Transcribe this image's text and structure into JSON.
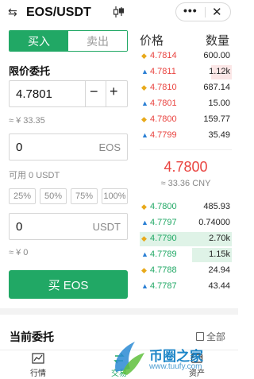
{
  "header": {
    "swap_icon": "⇆",
    "title": "EOS/USDT",
    "kline_icon": "candlestick-icon",
    "more_icon": "•••",
    "close_icon": "✕"
  },
  "form": {
    "tab_buy": "买入",
    "tab_sell": "卖出",
    "order_type": "限价委托",
    "price_value": "4.7801",
    "minus": "−",
    "plus": "+",
    "price_approx": "≈ ¥ 33.35",
    "amount_value": "0",
    "amount_unit": "EOS",
    "available": "可用 0 USDT",
    "pct": [
      "25%",
      "50%",
      "75%",
      "100%"
    ],
    "total_value": "0",
    "total_unit": "USDT",
    "total_approx": "≈ ¥ 0",
    "buy_button": "买 EOS"
  },
  "orderbook": {
    "header_price": "价格",
    "header_qty": "数量",
    "asks": [
      {
        "price": "4.7814",
        "qty": "600.00",
        "fill": 0.0
      },
      {
        "price": "4.7811",
        "qty": "1.12k",
        "fill": 0.22
      },
      {
        "price": "4.7810",
        "qty": "687.14",
        "fill": 0.0
      },
      {
        "price": "4.7801",
        "qty": "15.00",
        "fill": 0.0
      },
      {
        "price": "4.7800",
        "qty": "159.77",
        "fill": 0.0
      },
      {
        "price": "4.7799",
        "qty": "35.49",
        "fill": 0.0
      }
    ],
    "last_price": "4.7800",
    "last_price_cny": "≈ 33.36 CNY",
    "bids": [
      {
        "price": "4.7800",
        "qty": "485.93",
        "fill": 0.0
      },
      {
        "price": "4.7797",
        "qty": "0.74000",
        "fill": 0.0
      },
      {
        "price": "4.7790",
        "qty": "2.70k",
        "fill": 1.0
      },
      {
        "price": "4.7789",
        "qty": "1.15k",
        "fill": 0.43
      },
      {
        "price": "4.7788",
        "qty": "24.94",
        "fill": 0.0
      },
      {
        "price": "4.7787",
        "qty": "43.44",
        "fill": 0.0
      }
    ]
  },
  "orders": {
    "title": "当前委托",
    "all_link": "全部"
  },
  "tabbar": {
    "market": "行情",
    "trade": "交易",
    "assets": "资产"
  },
  "watermark": {
    "text": "币圈之家",
    "url": "www.tuufy.com"
  },
  "colors": {
    "green": "#21a865",
    "red": "#e9433f"
  }
}
